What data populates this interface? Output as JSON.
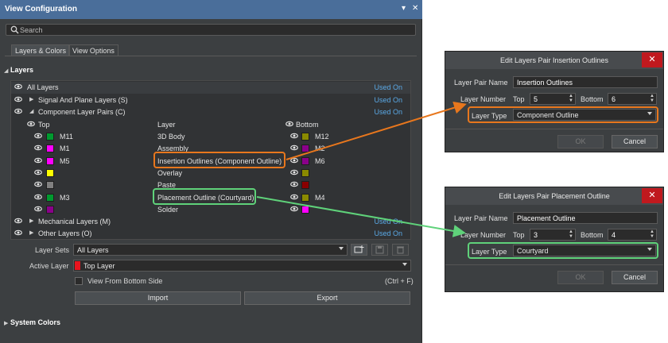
{
  "panel": {
    "title": "View Configuration",
    "pin_glyph": "▾",
    "close_glyph": "✕",
    "search_placeholder": "Search",
    "tabs": [
      "Layers & Colors",
      "View Options"
    ],
    "section_layers": "Layers",
    "section_system_colors": "System Colors"
  },
  "tree": {
    "all_layers": "All Layers",
    "used_on": "Used On",
    "signal_plane": "Signal And Plane Layers (S)",
    "component_pairs": "Component Layer Pairs (C)",
    "header_top": "Top",
    "header_layer": "Layer",
    "header_bottom": "Bottom",
    "pairs": [
      {
        "top_name": "M11",
        "top_color": "#009a2f",
        "layer": "3D Body",
        "bottom_name": "M12",
        "bottom_color": "#8a8a00"
      },
      {
        "top_name": "M1",
        "top_color": "#ff00ff",
        "layer": "Assembly",
        "bottom_name": "M2",
        "bottom_color": "#8a008a"
      },
      {
        "top_name": "M5",
        "top_color": "#ff00ff",
        "layer": "Insertion Outlines (Component Outline)",
        "bottom_name": "M6",
        "bottom_color": "#8a008a"
      },
      {
        "top_name": "",
        "top_color": "#ffff00",
        "layer": "Overlay",
        "bottom_name": "",
        "bottom_color": "#8a8a00"
      },
      {
        "top_name": "",
        "top_color": "#808080",
        "layer": "Paste",
        "bottom_name": "",
        "bottom_color": "#8a0000"
      },
      {
        "top_name": "M3",
        "top_color": "#009a2f",
        "layer": "Placement Outline (Courtyard)",
        "bottom_name": "M4",
        "bottom_color": "#8a8a00"
      },
      {
        "top_name": "",
        "top_color": "#8a008a",
        "layer": "Solder",
        "bottom_name": "",
        "bottom_color": "#ff00ff"
      }
    ],
    "mechanical": "Mechanical Layers (M)",
    "other": "Other Layers (O)"
  },
  "controls": {
    "layer_sets_label": "Layer Sets",
    "layer_sets_value": "All Layers",
    "active_layer_label": "Active Layer",
    "active_layer_value": "Top Layer",
    "active_layer_color": "#e8141e",
    "view_bottom_label": "View From Bottom Side",
    "view_bottom_shortcut": "(Ctrl + F)",
    "import_label": "Import",
    "export_label": "Export"
  },
  "dialog1": {
    "title": "Edit Layers Pair Insertion Outlines",
    "pair_name_label": "Layer Pair Name",
    "pair_name_value": "Insertion Outlines",
    "layer_number_label": "Layer Number",
    "top_label": "Top",
    "top_value": "5",
    "bottom_label": "Bottom",
    "bottom_value": "6",
    "layer_type_label": "Layer Type",
    "layer_type_value": "Component Outline",
    "ok_label": "OK",
    "cancel_label": "Cancel",
    "accent": "#e8771d"
  },
  "dialog2": {
    "title": "Edit Layers Pair Placement Outline",
    "pair_name_label": "Layer Pair Name",
    "pair_name_value": "Placement Outline",
    "layer_number_label": "Layer Number",
    "top_label": "Top",
    "top_value": "3",
    "bottom_label": "Bottom",
    "bottom_value": "4",
    "layer_type_label": "Layer Type",
    "layer_type_value": "Courtyard",
    "ok_label": "OK",
    "cancel_label": "Cancel",
    "accent": "#5fd27a"
  },
  "icons": {
    "eye": "eye-icon",
    "search": "search-icon",
    "expand": "chevron-right-icon",
    "collapse": "chevron-down-icon",
    "add_layer_set": "layer-add-icon",
    "save_layer_set": "save-icon",
    "delete_layer_set": "trash-icon"
  }
}
